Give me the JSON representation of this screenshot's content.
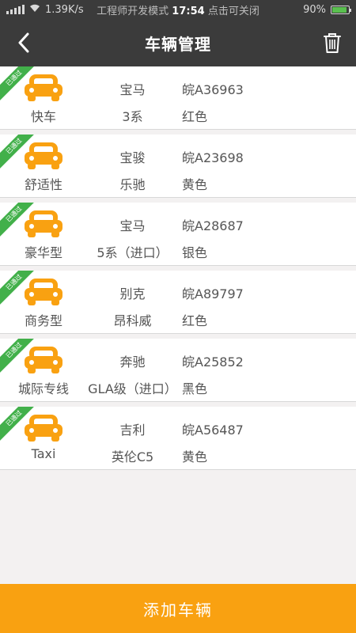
{
  "status_bar": {
    "speed": "1.39K/s",
    "notice": "工程师开发模式",
    "time": "17:54",
    "close_hint": "点击可关闭",
    "battery": "90%",
    "battery_level": 0.9
  },
  "header": {
    "title": "车辆管理"
  },
  "badge_label": "已通过",
  "vehicles": [
    {
      "type": "快车",
      "brand": "宝马",
      "model": "3系",
      "plate": "皖A36963",
      "color": "红色"
    },
    {
      "type": "舒适性",
      "brand": "宝骏",
      "model": "乐驰",
      "plate": "皖A23698",
      "color": "黄色"
    },
    {
      "type": "豪华型",
      "brand": "宝马",
      "model": "5系（进口）",
      "plate": "皖A28687",
      "color": "银色"
    },
    {
      "type": "商务型",
      "brand": "别克",
      "model": "昂科威",
      "plate": "皖A89797",
      "color": "红色"
    },
    {
      "type": "城际专线",
      "brand": "奔驰",
      "model": "GLA级（进口）",
      "plate": "皖A25852",
      "color": "黑色"
    },
    {
      "type": "Taxi",
      "brand": "吉利",
      "model": "英伦C5",
      "plate": "皖A56487",
      "color": "黄色"
    }
  ],
  "footer": {
    "add_label": "添加车辆"
  },
  "colors": {
    "accent": "#f9a111",
    "badge": "#42b04a",
    "header_bg": "#3b3b3b"
  }
}
